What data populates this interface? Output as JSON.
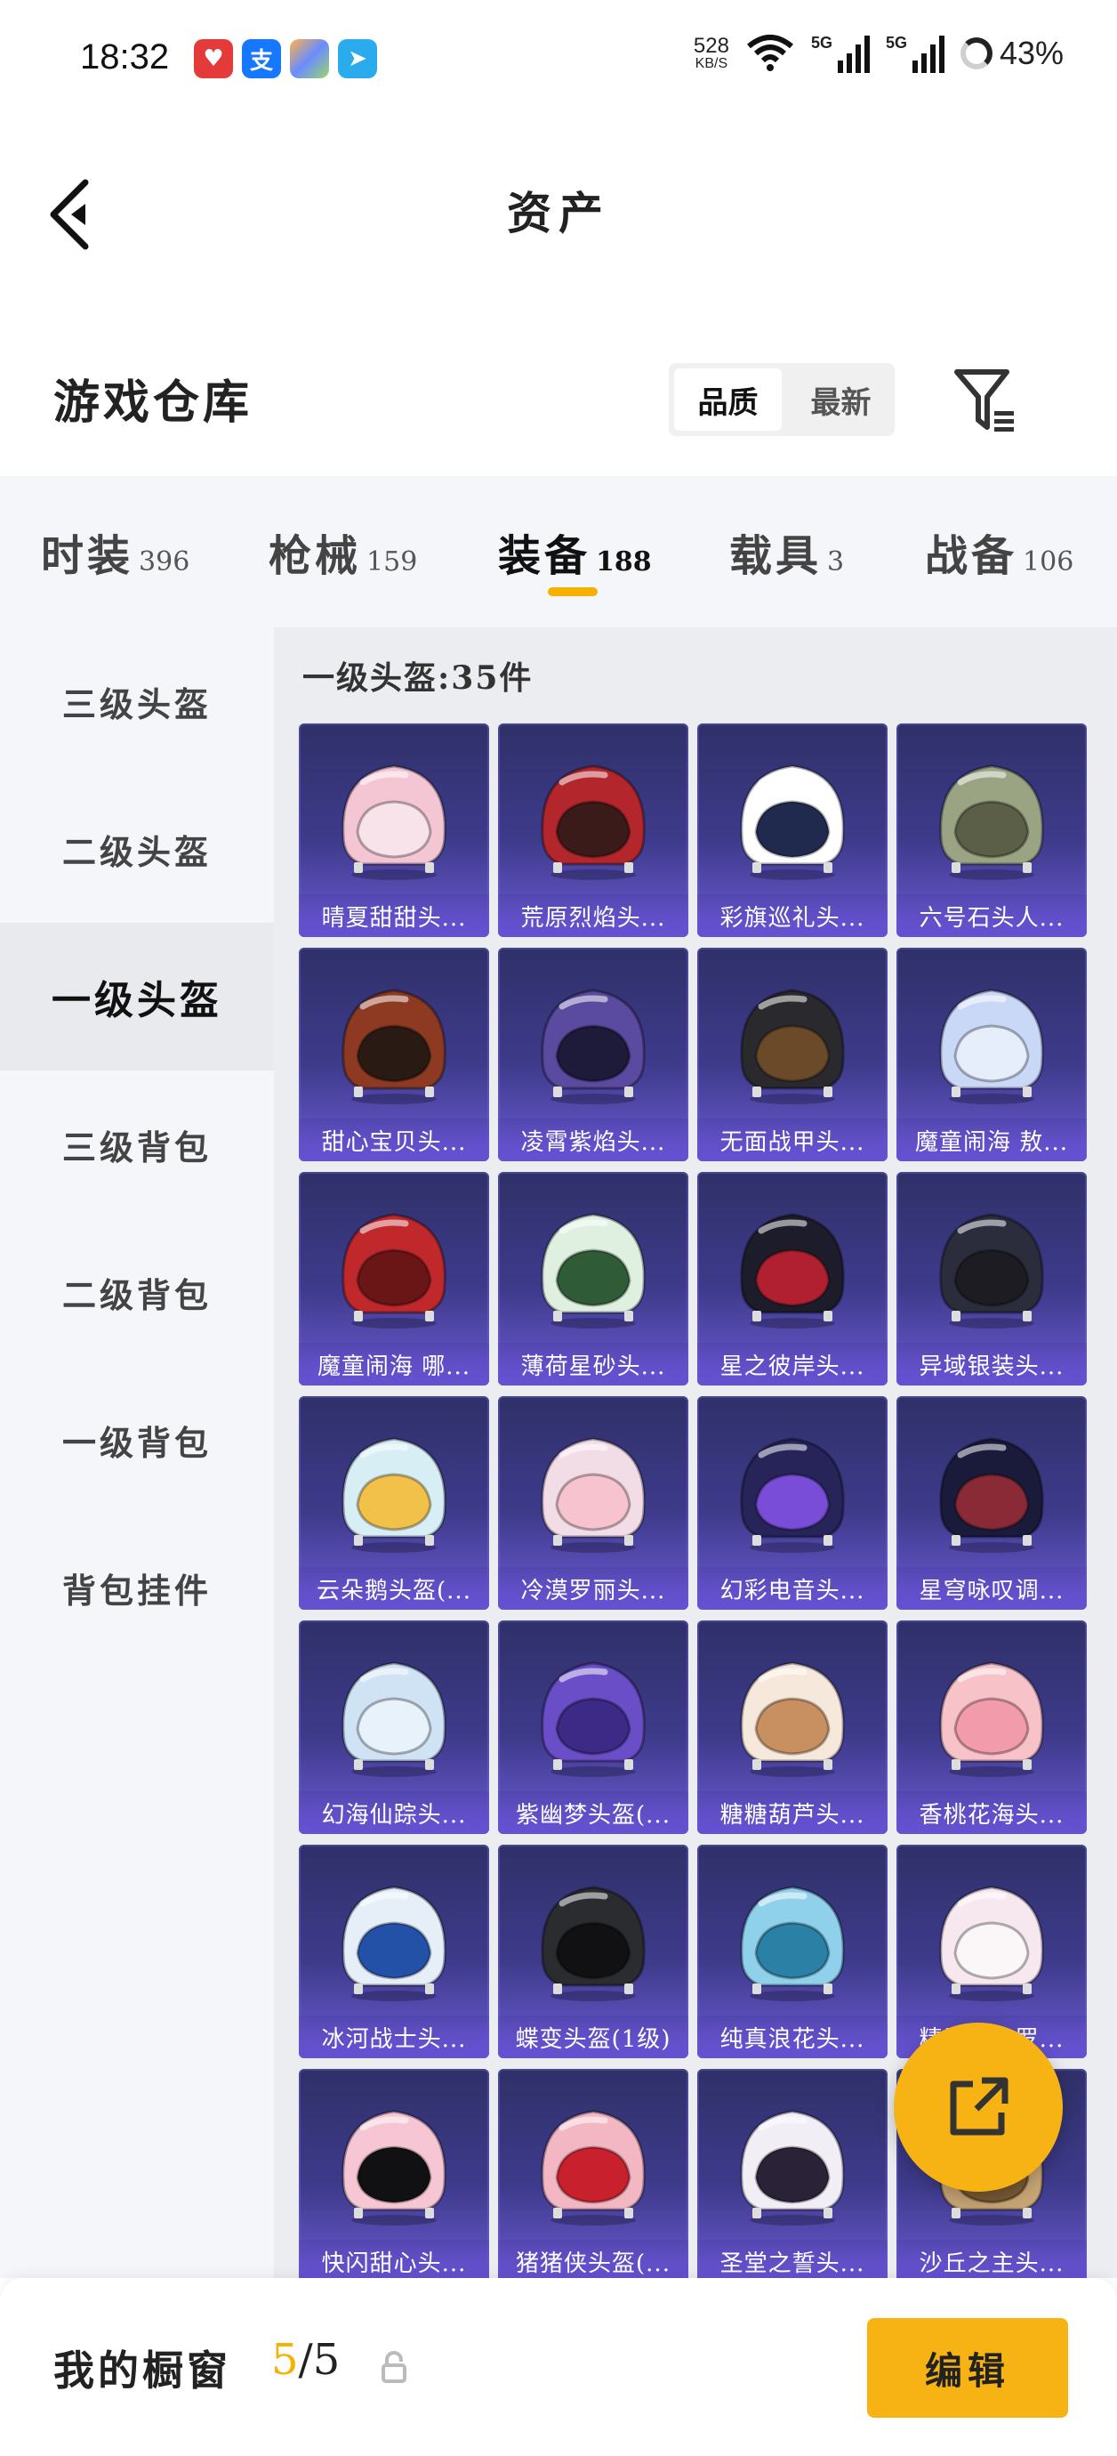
{
  "status": {
    "time": "18:32",
    "net_speed": "528",
    "net_unit": "KB/S",
    "signal1_label": "5G",
    "signal2_label": "5G",
    "battery": "43%",
    "apps": [
      {
        "icon": "heart-app-icon",
        "color": "#e53a3a"
      },
      {
        "icon": "alipay-icon",
        "color": "#1677ff",
        "glyph": "支"
      },
      {
        "icon": "gallery-app-icon",
        "color": "#6a8cff"
      },
      {
        "icon": "telegram-icon",
        "color": "#2aabee"
      }
    ]
  },
  "header": {
    "title": "资产"
  },
  "section": {
    "title": "游戏仓库",
    "sort": [
      "品质",
      "最新"
    ]
  },
  "tabs": [
    {
      "label": "时装",
      "count": "396"
    },
    {
      "label": "枪械",
      "count": "159"
    },
    {
      "label": "装备",
      "count": "188"
    },
    {
      "label": "载具",
      "count": "3"
    },
    {
      "label": "战备",
      "count": "106"
    }
  ],
  "sidebar": [
    "三级头盔",
    "二级头盔",
    "一级头盔",
    "三级背包",
    "二级背包",
    "一级背包",
    "背包挂件"
  ],
  "content": {
    "heading": "一级头盔:35件",
    "items": [
      {
        "name": "晴夏甜甜头...",
        "color": "#f4c6d3",
        "visor": "#f9e3ea"
      },
      {
        "name": "荒原烈焰头...",
        "color": "#b3262b",
        "visor": "#3b1a1a"
      },
      {
        "name": "彩旗巡礼头...",
        "color": "#ffffff",
        "visor": "#1f2a4e"
      },
      {
        "name": "六号石头人...",
        "color": "#9aa382",
        "visor": "#5b5f48"
      },
      {
        "name": "甜心宝贝头...",
        "color": "#8e3a22",
        "visor": "#2a1a14"
      },
      {
        "name": "凌霄紫焰头...",
        "color": "#5a4aa0",
        "visor": "#1d1a3a"
      },
      {
        "name": "无面战甲头...",
        "color": "#2a2a2e",
        "visor": "#6b4a2a"
      },
      {
        "name": "魔童闹海 敖...",
        "color": "#c9d8f6",
        "visor": "#e6eefc"
      },
      {
        "name": "魔童闹海 哪...",
        "color": "#c0282c",
        "visor": "#6b1616"
      },
      {
        "name": "薄荷星砂头...",
        "color": "#e0f0e0",
        "visor": "#2f5c36"
      },
      {
        "name": "星之彼岸头...",
        "color": "#1d1c2a",
        "visor": "#b02030"
      },
      {
        "name": "异域银装头...",
        "color": "#2c2d3c",
        "visor": "#1c1c22"
      },
      {
        "name": "云朵鹅头盔(...",
        "color": "#d6eef4",
        "visor": "#f2c14a"
      },
      {
        "name": "冷漠罗丽头...",
        "color": "#f2dce6",
        "visor": "#f6c3cf"
      },
      {
        "name": "幻彩电音头...",
        "color": "#27245a",
        "visor": "#7a4dd8"
      },
      {
        "name": "星穹咏叹调...",
        "color": "#1a1b3a",
        "visor": "#8a2a36"
      },
      {
        "name": "幻海仙踪头...",
        "color": "#cfe3f4",
        "visor": "#e8f2fb"
      },
      {
        "name": "紫幽梦头盔(...",
        "color": "#6a4ec8",
        "visor": "#3c2a86"
      },
      {
        "name": "糖糖葫芦头...",
        "color": "#f6e8da",
        "visor": "#c89060"
      },
      {
        "name": "香桃花海头...",
        "color": "#f7c2c8",
        "visor": "#f29cab"
      },
      {
        "name": "冰河战士头...",
        "color": "#e6eef8",
        "visor": "#2451a8"
      },
      {
        "name": "蝶变头盔(1级)",
        "color": "#2b2c30",
        "visor": "#111114"
      },
      {
        "name": "纯真浪花头...",
        "color": "#8fd0ea",
        "visor": "#2b80a6"
      },
      {
        "name": "精灵花之罗...",
        "color": "#f6e8ee",
        "visor": "#fbf6f8"
      },
      {
        "name": "快闪甜心头...",
        "color": "#f6c6d4",
        "visor": "#111114"
      },
      {
        "name": "猪猪侠头盔(...",
        "color": "#f3b7c4",
        "visor": "#c8202c"
      },
      {
        "name": "圣堂之誓头...",
        "color": "#f2eef6",
        "visor": "#2a2236"
      },
      {
        "name": "沙丘之主头...",
        "color": "#c7a574",
        "visor": "#7a5a34"
      }
    ]
  },
  "bottom": {
    "label": "我的橱窗",
    "used": "5",
    "total": "/5",
    "edit": "编辑"
  },
  "colors": {
    "accent": "#f7b313"
  }
}
